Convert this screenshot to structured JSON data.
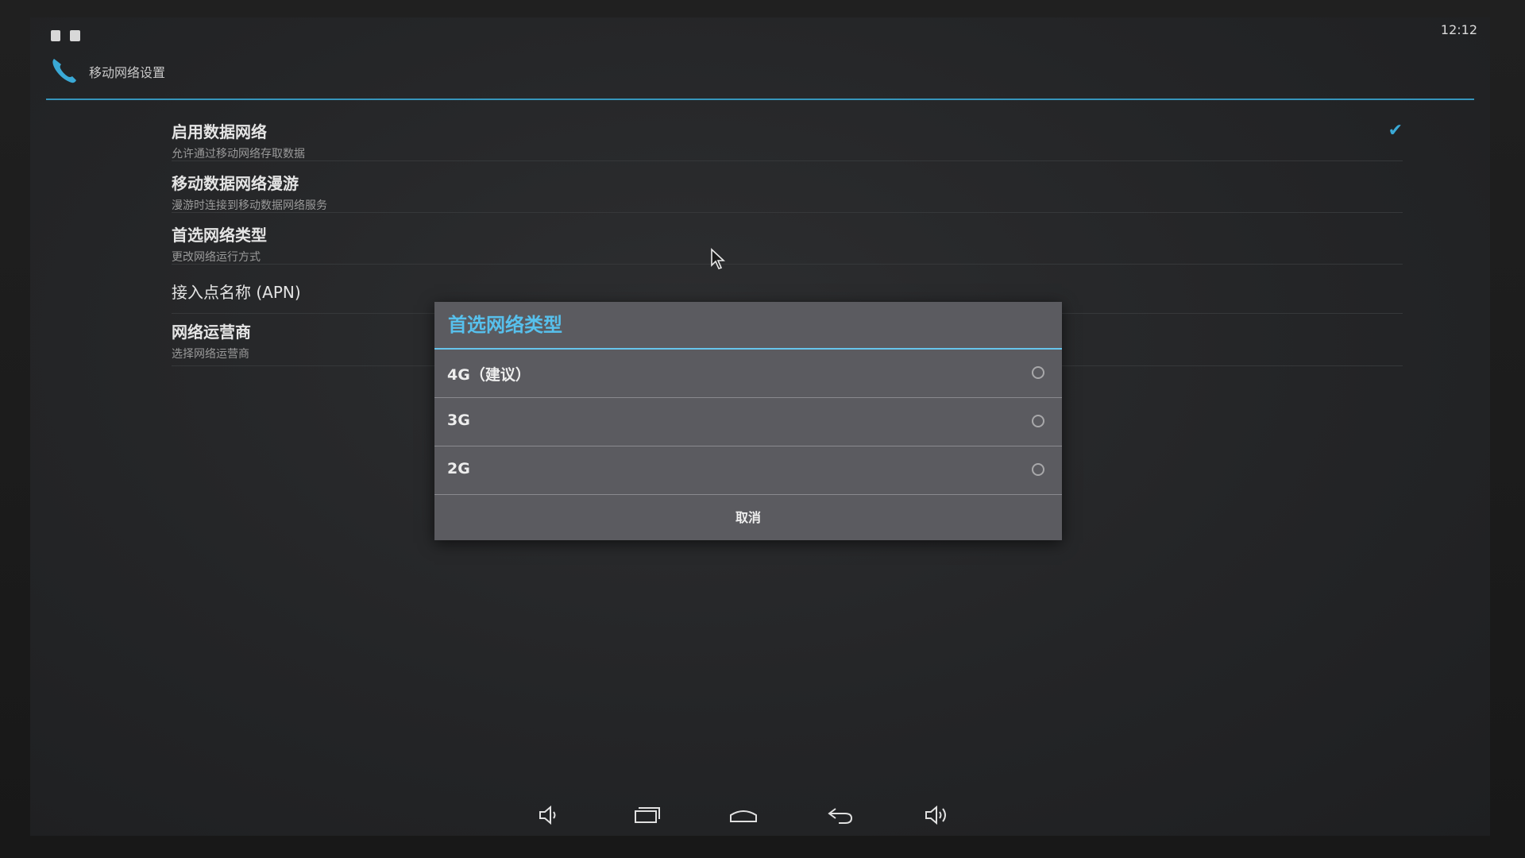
{
  "status_bar": {
    "time": "12:12"
  },
  "action_bar": {
    "title": "移动网络设置"
  },
  "preferences": [
    {
      "title": "启用数据网络",
      "summary": "允许通过移动网络存取数据",
      "checked": true
    },
    {
      "title": "移动数据网络漫游",
      "summary": "漫游时连接到移动数据网络服务"
    },
    {
      "title": "首选网络类型",
      "summary": "更改网络运行方式"
    },
    {
      "title": "接入点名称 (APN)",
      "summary": ""
    },
    {
      "title": "网络运营商",
      "summary": "选择网络运营商"
    }
  ],
  "dialog": {
    "title": "首选网络类型",
    "options": [
      {
        "label": "4G（建议）",
        "selected": false
      },
      {
        "label": "3G",
        "selected": false
      },
      {
        "label": "2G",
        "selected": false
      }
    ],
    "cancel_label": "取消"
  },
  "nav_bar": {
    "icons": [
      "volume-down-icon",
      "recent-apps-icon",
      "home-icon",
      "back-icon",
      "volume-up-icon"
    ]
  },
  "colors": {
    "accent": "#3aa9d6",
    "dialog_bg": "#5b5b60"
  }
}
